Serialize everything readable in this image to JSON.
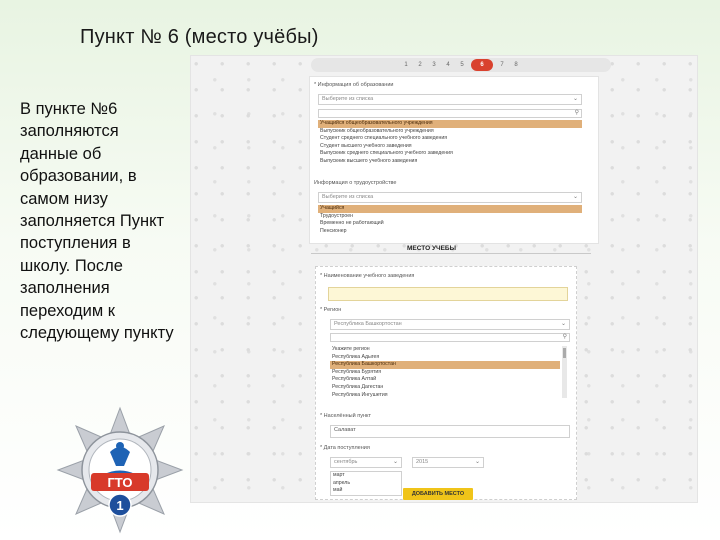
{
  "slide": {
    "title": "Пункт  № 6 (место учёбы)",
    "description": "В пункте №6 заполняются данные об образовании, в самом низу заполняется Пункт поступления в школу. После заполнения переходим к следующему пункту"
  },
  "badge": {
    "text": "ГТО",
    "number": "1"
  },
  "stepper": {
    "steps": [
      "1",
      "2",
      "3",
      "4",
      "5",
      "6",
      "7",
      "8"
    ],
    "active_index": 5
  },
  "education": {
    "label": "* Информация об образовании",
    "field_value": "Выберите из списка",
    "options": [
      "Учащийся общеобразовательного учреждения",
      "Выпускник общеобразовательного учреждения",
      "Студент среднего специального учебного заведения",
      "Студент высшего учебного заведения",
      "Выпускник среднего специального учебного заведения",
      "Выпускник высшего учебного заведения"
    ],
    "selected_index": 0
  },
  "employment": {
    "label": "Информация о трудоустройстве",
    "field_value": "Выберите из списка",
    "options": [
      "Учащийся",
      "Трудоустроен",
      "Временно не работающий",
      "Пенсионер"
    ],
    "selected_index": 0
  },
  "section": {
    "title": "МЕСТО УЧЕБЫ"
  },
  "school": {
    "label": "* Наименование учебного заведения",
    "value": ""
  },
  "region": {
    "label": "* Регион",
    "field_value": "Республика Башкортостан",
    "options": [
      "Укажите регион",
      "Республика Адыгея",
      "Республика Башкортостан",
      "Республика Бурятия",
      "Республика Алтай",
      "Республика Дагестан",
      "Республика Ингушетия"
    ],
    "selected_index": 2
  },
  "city": {
    "label": "* Населённый пункт",
    "value": "Салават"
  },
  "admission": {
    "label": "* Дата поступления",
    "month_value": "сентябрь",
    "year_value": "2015",
    "month_options": [
      "март",
      "апрель",
      "май"
    ]
  },
  "submit": {
    "label": "ДОБАВИТЬ МЕСТО УЧЕБЫ"
  },
  "colors": {
    "accent": "#d9412e",
    "selected_option": "#e0b07a",
    "submit": "#f0c419"
  }
}
